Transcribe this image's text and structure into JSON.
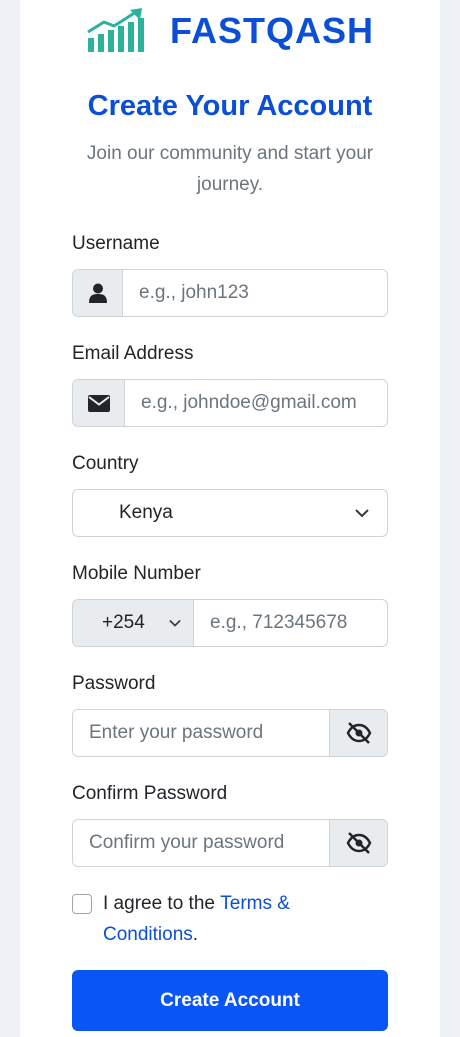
{
  "brand": {
    "name": "FASTQASH",
    "logo_icon": "growth-chart-logo-icon"
  },
  "header": {
    "title": "Create Your Account",
    "subtitle": "Join our community and start your journey."
  },
  "form": {
    "username": {
      "label": "Username",
      "placeholder": "e.g., john123",
      "icon": "user-icon"
    },
    "email": {
      "label": "Email Address",
      "placeholder": "e.g., johndoe@gmail.com",
      "icon": "envelope-icon"
    },
    "country": {
      "label": "Country",
      "value": "Kenya"
    },
    "mobile": {
      "label": "Mobile Number",
      "code": "+254",
      "placeholder": "e.g., 712345678"
    },
    "password": {
      "label": "Password",
      "placeholder": "Enter your password",
      "toggle_icon": "eye-slash-icon"
    },
    "confirm": {
      "label": "Confirm Password",
      "placeholder": "Confirm your password",
      "toggle_icon": "eye-slash-icon"
    },
    "terms": {
      "prefix": "I agree to the ",
      "link": "Terms & Conditions",
      "suffix": ".",
      "checked": false
    },
    "submit_label": "Create Account"
  },
  "colors": {
    "brand": "#0b4fd6",
    "button": "#0a55f5",
    "logo": "#2ab39a"
  }
}
